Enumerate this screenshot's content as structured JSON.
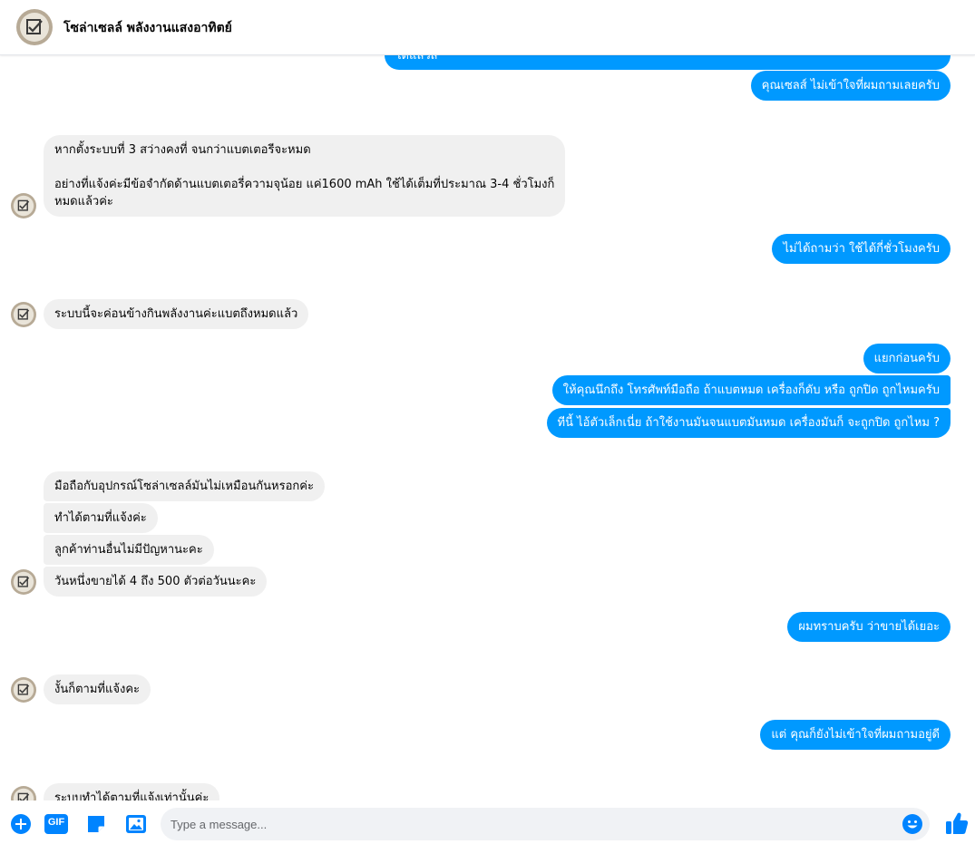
{
  "header": {
    "title": "โซล่าเซลล์ พลังงานแสงอาทิตย์"
  },
  "messages": [
    {
      "id": "m0",
      "side": "out",
      "lines": [
        "ได้แล้วส"
      ]
    },
    {
      "id": "m1",
      "side": "out",
      "lines": [
        "คุณเซลส์ ไม่เข้าใจที่ผมถามเลยครับ"
      ]
    },
    {
      "id": "m2",
      "side": "in",
      "lines": [
        "หากตั้งระบบที่ 3 สว่างคงที่ จนกว่าแบตเตอรีจะหมด",
        "",
        "อย่างที่แจ้งค่ะมีข้อจำกัดด้านแบตเตอรี่ความจุน้อย แค่1600 mAh ใช้ได้เต็มที่ประมาณ 3-4 ชั่วโมงก็",
        "หมดแล้วค่ะ"
      ]
    },
    {
      "id": "m3",
      "side": "out",
      "lines": [
        "ไม่ได้ถามว่า ใช้ได้กี่ชั่วโมงครับ"
      ]
    },
    {
      "id": "m4",
      "side": "in",
      "lines": [
        "ระบบนี้จะค่อนข้างกินพลังงานค่ะแบตถึงหมดแล้ว"
      ]
    },
    {
      "id": "m5",
      "side": "out",
      "lines": [
        "แยกก่อนครับ"
      ]
    },
    {
      "id": "m6",
      "side": "out",
      "lines": [
        "ให้คุณนึกถึง โทรศัพท์มือถือ  ถ้าแบตหมด  เครื่องก็ดับ หรือ ถูกปิด  ถูกไหมครับ"
      ]
    },
    {
      "id": "m7",
      "side": "out",
      "lines": [
        "ทีนี้  ไอ้ตัวเล็กเนี่ย  ถ้าใช้งานมันจนแบตมันหมด   เครื่องมันก็ จะถูกปิด ถูกไหม ?"
      ]
    },
    {
      "id": "m8",
      "side": "in",
      "lines": [
        "มือถือกับอุปกรณ์โซล่าเซลล์มันไม่เหมือนกันหรอกค่ะ"
      ]
    },
    {
      "id": "m9",
      "side": "in",
      "lines": [
        "ทำได้ตามที่แจ้งค่ะ"
      ]
    },
    {
      "id": "m10",
      "side": "in",
      "lines": [
        "ลูกค้าท่านอื่นไม่มีปัญหานะคะ"
      ]
    },
    {
      "id": "m11",
      "side": "in",
      "lines": [
        "วันหนึ่งขายได้ 4 ถึง 500 ตัวต่อวันนะคะ"
      ]
    },
    {
      "id": "m12",
      "side": "out",
      "lines": [
        "ผมทราบครับ ว่าขายได้เยอะ"
      ]
    },
    {
      "id": "m13",
      "side": "in",
      "lines": [
        "งั้นก็ตามที่แจ้งคะ"
      ]
    },
    {
      "id": "m14",
      "side": "out",
      "lines": [
        "แต่ คุณก็ยังไม่เข้าใจที่ผมถามอยู่ดี"
      ]
    },
    {
      "id": "m15",
      "side": "in",
      "lines": [
        "ระบบทำได้ตามที่แจ้งเท่านั้นค่ะ"
      ]
    }
  ],
  "composer": {
    "placeholder": "Type a message...",
    "gif_label": "GIF"
  },
  "colors": {
    "outgoing_bubble": "#0099ff",
    "incoming_bubble": "#f0f0f0",
    "accent": "#0084ff"
  },
  "icons": [
    "plus-circle-icon",
    "gif-icon",
    "sticker-icon",
    "image-icon",
    "emoji-icon",
    "thumbs-up-icon"
  ]
}
